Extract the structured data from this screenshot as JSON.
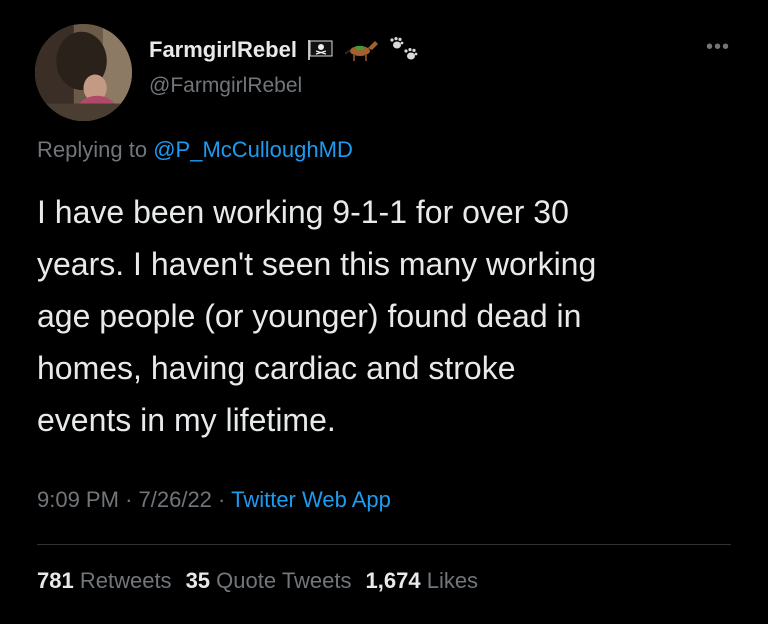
{
  "user": {
    "display_name": "FarmgirlRebel",
    "handle": "@FarmgirlRebel",
    "name_emojis": [
      "pirate-flag-icon",
      "horse-icon",
      "paw-prints-icon"
    ]
  },
  "more_icon": "more-options-icon",
  "reply": {
    "prefix": "Replying to",
    "mention": "@P_McCulloughMD"
  },
  "tweet": {
    "text": "I have been working 9-1-1 for over 30\nyears. I haven't seen this many working\nage people (or younger) found dead in\nhomes, having cardiac and stroke\nevents in my lifetime."
  },
  "meta": {
    "time": "9:09 PM",
    "sep1": "·",
    "date": "7/26/22",
    "sep2": "·",
    "source": "Twitter Web App"
  },
  "stats": {
    "retweets_count": "781",
    "retweets_label": "Retweets",
    "quotes_count": "35",
    "quotes_label": "Quote Tweets",
    "likes_count": "1,674",
    "likes_label": "Likes"
  },
  "colors": {
    "background": "#000000",
    "text": "#e7e9ea",
    "secondary": "#71767b",
    "link": "#1d9bf0",
    "divider": "#2f3336"
  }
}
